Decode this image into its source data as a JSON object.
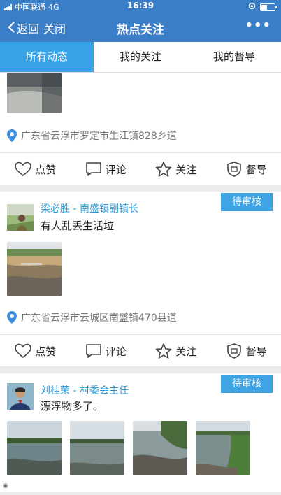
{
  "status_bar": {
    "carrier": "中国联通",
    "network": "4G",
    "time": "16:39"
  },
  "nav": {
    "back_label": "返回",
    "close_label": "关闭",
    "title": "热点关注",
    "more_label": "•••"
  },
  "tabs": [
    {
      "label": "所有动态",
      "active": true
    },
    {
      "label": "我的关注",
      "active": false
    },
    {
      "label": "我的督导",
      "active": false
    }
  ],
  "actions": {
    "like": "点赞",
    "comment": "评论",
    "follow": "关注",
    "supervise": "督导"
  },
  "posts": [
    {
      "location": "广东省云浮市罗定市生江镇828乡道"
    },
    {
      "author": "梁必胜 - 南盛镇副镇长",
      "text": "有人乱丢生活垃",
      "status": "待审核",
      "location": "广东省云浮市云城区南盛镇470县道"
    },
    {
      "author": "刘桂荣 - 村委会主任",
      "text": "漂浮物多了。",
      "status": "待审核"
    }
  ],
  "colors": {
    "brand": "#3b7ec8",
    "tab_active": "#37a3e8",
    "author": "#2f9bd6",
    "badge": "#3fa4e4"
  }
}
